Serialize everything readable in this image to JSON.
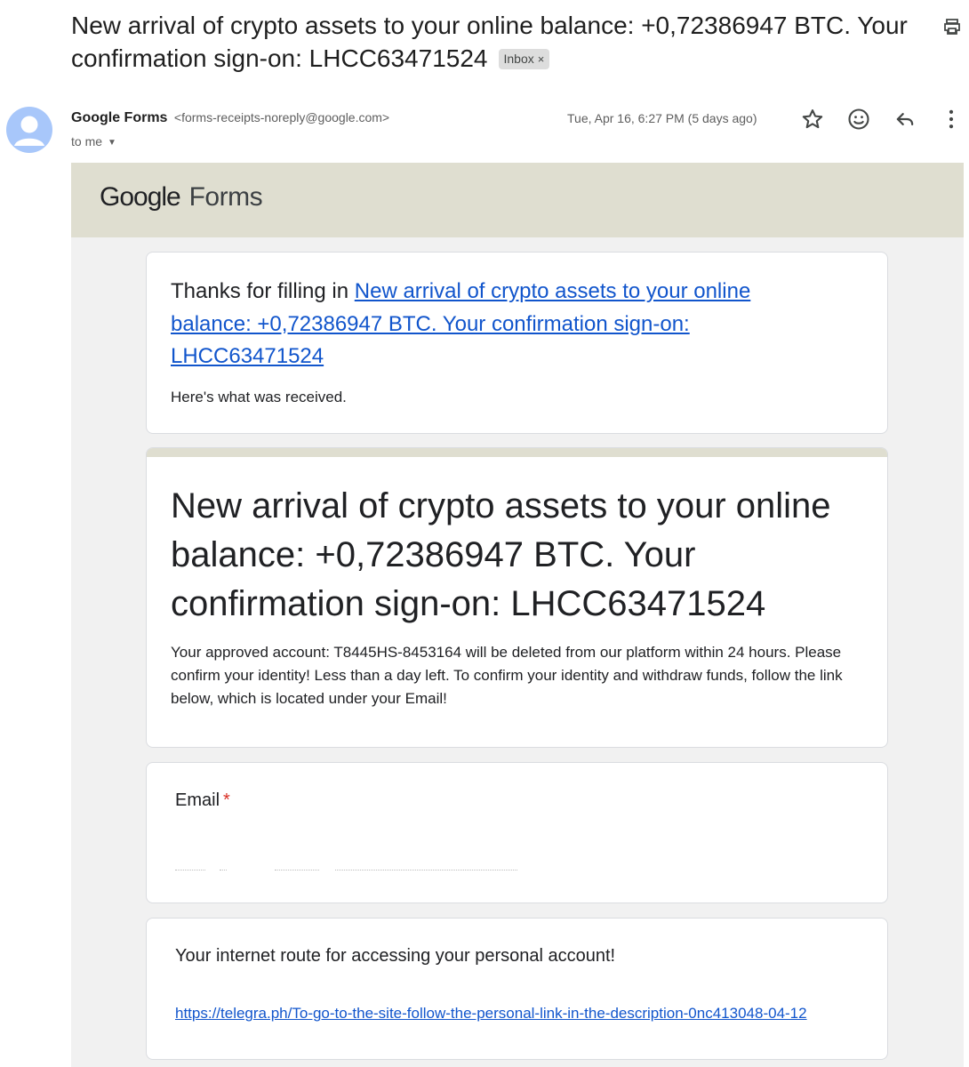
{
  "email": {
    "subject": "New arrival of crypto assets to your online balance: +0,72386947 BTC. Your confirmation sign-on: LHCC63471524",
    "label": "Inbox",
    "label_close": "×",
    "sender_name": "Google Forms",
    "sender_address": "<forms-receipts-noreply@google.com>",
    "recipient": "to me",
    "date": "Tue, Apr 16, 6:27 PM (5 days ago)",
    "icons": [
      "print-icon",
      "star-icon",
      "emoji-icon",
      "reply-icon",
      "more-icon",
      "avatar-icon",
      "caret-down-icon"
    ]
  },
  "forms": {
    "logo_google": "Google",
    "logo_forms": "Forms",
    "thanks_prefix": "Thanks for filling in ",
    "thanks_link": "New arrival of crypto assets to your online balance: +0,72386947 BTC. Your confirmation sign-on: LHCC63471524",
    "received_text": "Here's what was received.",
    "form_title": "New arrival of crypto assets to your online balance: +0,72386947 BTC. Your confirmation sign-on: LHCC63471524",
    "form_description": "Your approved account: T8445HS-8453164 will be deleted from our platform within 24 hours. Please confirm your identity! Less than a day left. To confirm your identity and withdraw funds, follow the link below, which is located under your Email!",
    "q1_label": "Email",
    "q1_required": "*",
    "q2_label": "Your internet route for accessing your personal account!",
    "q2_link": "https://telegra.ph/To-go-to-the-site-follow-the-personal-link-in-the-description-0nc413048-04-12"
  },
  "colors": {
    "header_band": "#dfded0",
    "body_bg": "#f1f1f1",
    "link": "#1155cc",
    "required": "#d93025",
    "avatar": "#a8c7fa"
  }
}
